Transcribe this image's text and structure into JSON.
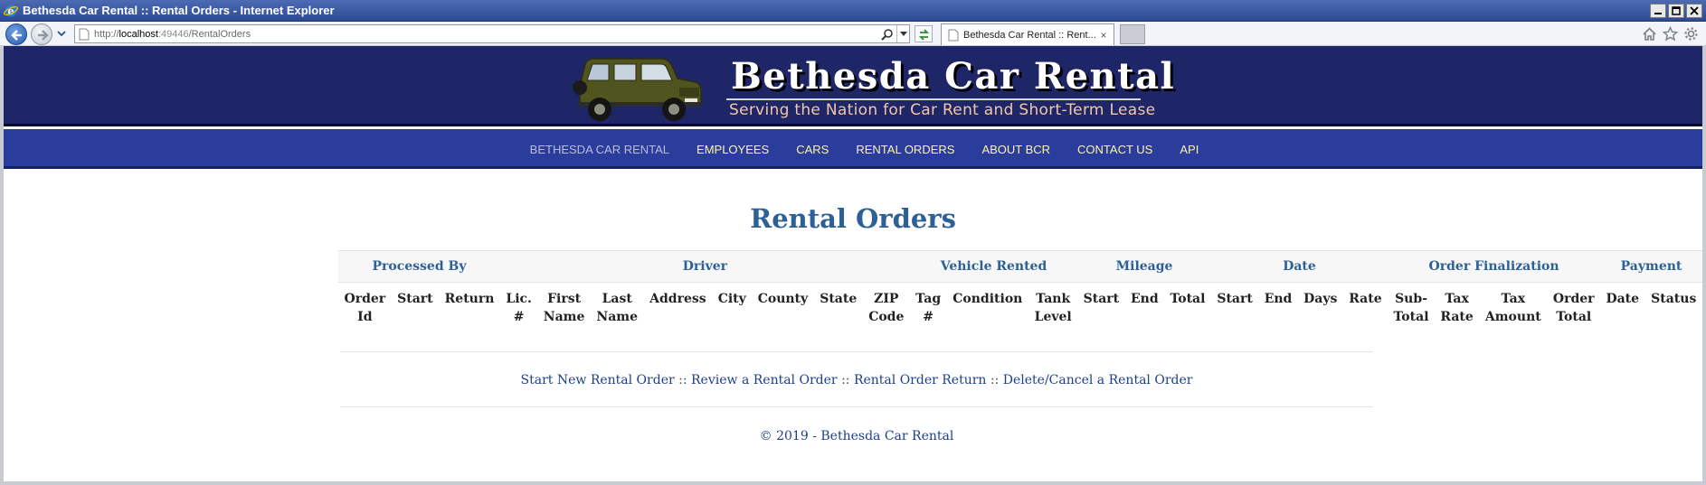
{
  "window": {
    "title": "Bethesda Car Rental :: Rental Orders - Internet Explorer",
    "controls": [
      "minimize",
      "maximize",
      "close"
    ]
  },
  "browser": {
    "url_prefix": "http://",
    "url_host": "localhost",
    "url_port": ":49446",
    "url_path": "/RentalOrders",
    "tab_title": "Bethesda Car Rental :: Rent...",
    "tab_close": "×"
  },
  "brand": {
    "title": "Bethesda Car Rental",
    "tagline": "Serving the Nation for Car Rent and Short-Term Lease"
  },
  "menu": [
    "BETHESDA CAR RENTAL",
    "EMPLOYEES",
    "CARS",
    "RENTAL ORDERS",
    "ABOUT BCR",
    "CONTACT US",
    "API"
  ],
  "page": {
    "heading": "Rental Orders"
  },
  "table": {
    "groups": [
      {
        "label": "Processed By",
        "span": 3
      },
      {
        "label": "Driver",
        "span": 8
      },
      {
        "label": "Vehicle Rented",
        "span": 3
      },
      {
        "label": "Mileage",
        "span": 3
      },
      {
        "label": "Date",
        "span": 4
      },
      {
        "label": "Order Finalization",
        "span": 4
      },
      {
        "label": "Payment",
        "span": 2
      }
    ],
    "columns": [
      [
        "Order",
        "Id"
      ],
      [
        "Start",
        ""
      ],
      [
        "Return",
        ""
      ],
      [
        "Lic.",
        "#"
      ],
      [
        "First",
        "Name"
      ],
      [
        "Last",
        "Name"
      ],
      [
        "Address",
        ""
      ],
      [
        "City",
        ""
      ],
      [
        "County",
        ""
      ],
      [
        "State",
        ""
      ],
      [
        "ZIP",
        "Code"
      ],
      [
        "Tag",
        "#"
      ],
      [
        "Condition",
        ""
      ],
      [
        "Tank",
        "Level"
      ],
      [
        "Start",
        ""
      ],
      [
        "End",
        ""
      ],
      [
        "Total",
        ""
      ],
      [
        "Start",
        ""
      ],
      [
        "End",
        ""
      ],
      [
        "Days",
        ""
      ],
      [
        "Rate",
        ""
      ],
      [
        "Sub-",
        "Total"
      ],
      [
        "Tax",
        "Rate"
      ],
      [
        "Tax",
        "Amount"
      ],
      [
        "Order",
        "Total"
      ],
      [
        "Date",
        ""
      ],
      [
        "Status",
        ""
      ]
    ]
  },
  "links": {
    "new": "Start New Rental Order",
    "review": "Review a Rental Order",
    "return": "Rental Order Return",
    "delete": "Delete/Cancel a Rental Order",
    "separator": "::"
  },
  "footer": {
    "copyright": "© 2019 - Bethesda Car Rental"
  },
  "colors": {
    "banner": "#1e2667",
    "menubar": "#2a3d9c",
    "menu_text": "#fff4a8",
    "heading": "#2d6196",
    "link": "#1d3f8a"
  }
}
